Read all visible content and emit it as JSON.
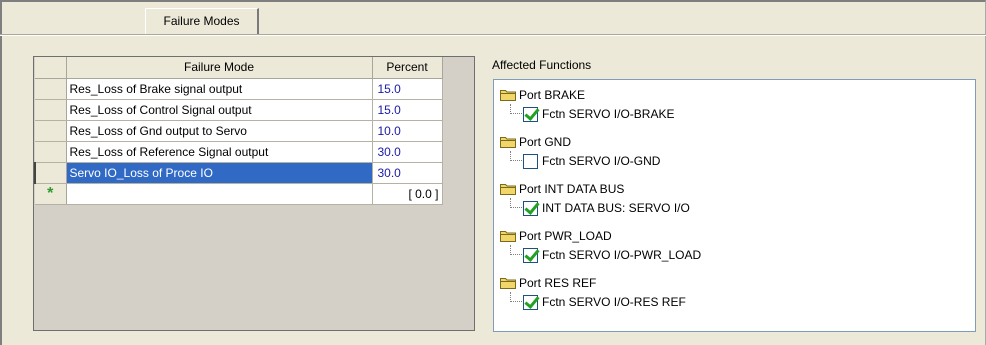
{
  "tab": {
    "label": "Failure Modes"
  },
  "grid": {
    "headers": {
      "mode": "Failure Mode",
      "percent": "Percent"
    },
    "rows": [
      {
        "mode": "Res_Loss of Brake signal output",
        "percent": "15.0"
      },
      {
        "mode": "Res_Loss of Control Signal output",
        "percent": "15.0"
      },
      {
        "mode": "Res_Loss of Gnd output to Servo",
        "percent": "10.0"
      },
      {
        "mode": "Res_Loss of Reference Signal output",
        "percent": "30.0"
      },
      {
        "mode": "Servo IO_Loss of Proce IO",
        "percent": "30.0",
        "selected": true
      }
    ],
    "new_row": {
      "marker": "*",
      "percent": "[ 0.0 ]"
    }
  },
  "affected": {
    "label": "Affected Functions",
    "ports": [
      {
        "name": "Port BRAKE",
        "function": "Fctn SERVO I/O-BRAKE",
        "checked": true
      },
      {
        "name": "Port GND",
        "function": "Fctn SERVO I/O-GND",
        "checked": false
      },
      {
        "name": "Port INT DATA BUS",
        "function": "INT DATA BUS: SERVO I/O",
        "checked": true
      },
      {
        "name": "Port PWR_LOAD",
        "function": "Fctn SERVO I/O-PWR_LOAD",
        "checked": true
      },
      {
        "name": "Port RES REF",
        "function": "Fctn SERVO I/O-RES REF",
        "checked": true
      }
    ]
  },
  "colors": {
    "selection": "#316ac5",
    "check": "#21a121",
    "folder": "#e8c94a"
  },
  "icons": {
    "folder": "folder-icon",
    "check": "checkmark-icon",
    "new_row": "asterisk-icon"
  }
}
